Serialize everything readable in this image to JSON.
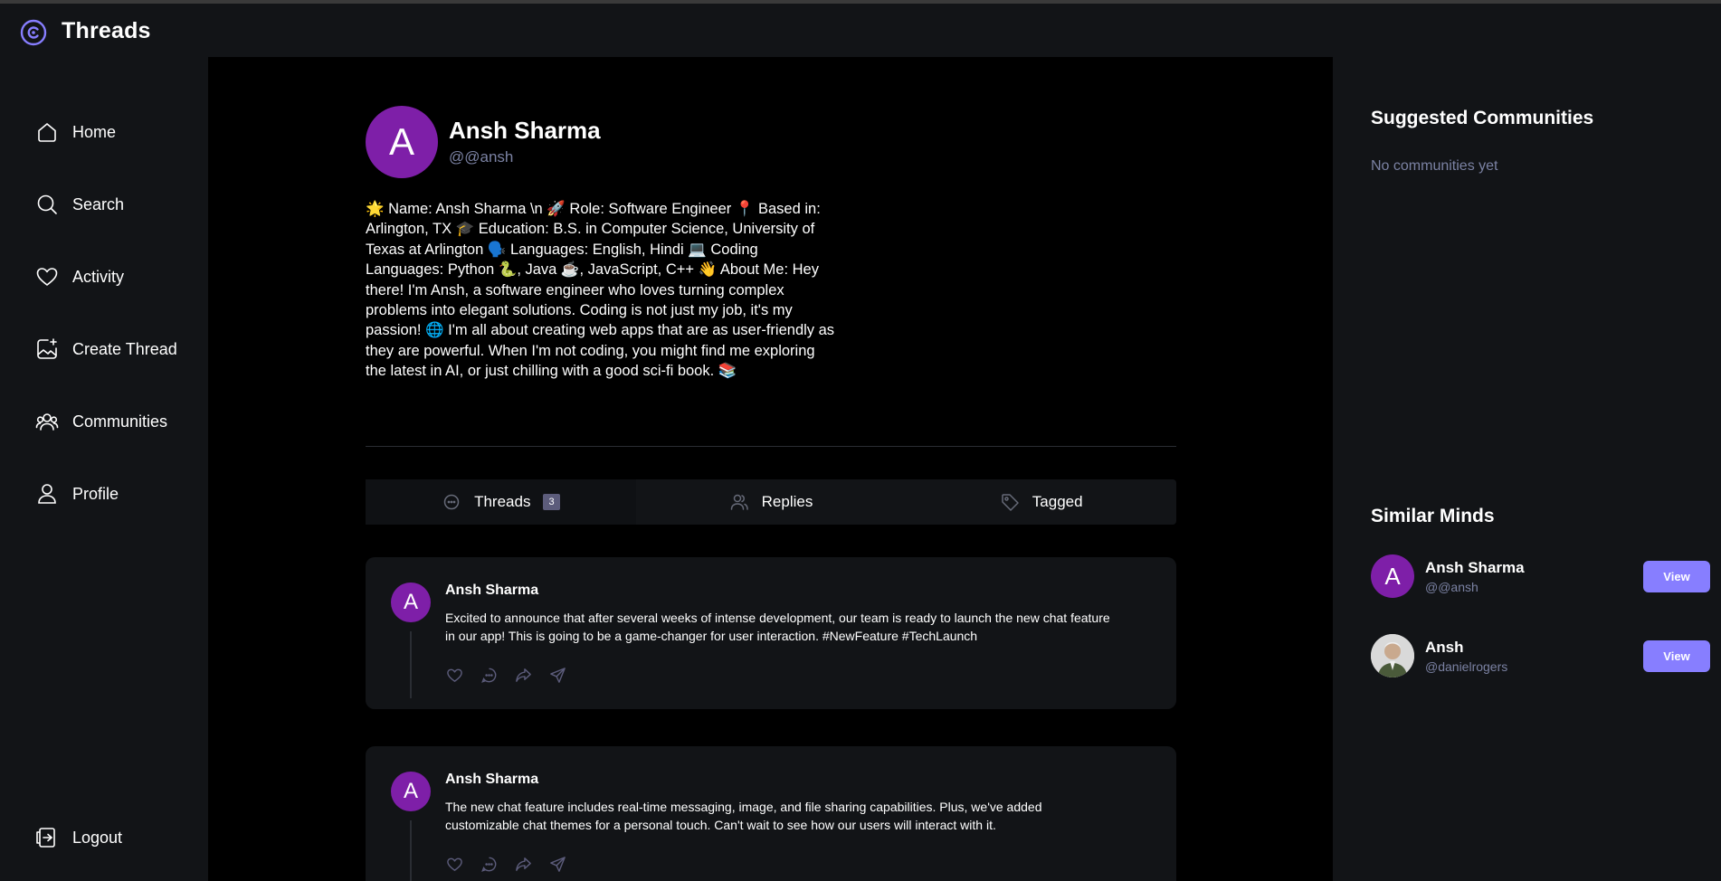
{
  "app": {
    "title": "Threads"
  },
  "sidebar": {
    "items": [
      {
        "label": "Home",
        "icon": "home-icon"
      },
      {
        "label": "Search",
        "icon": "search-icon"
      },
      {
        "label": "Activity",
        "icon": "heart-icon"
      },
      {
        "label": "Create Thread",
        "icon": "create-thread-icon"
      },
      {
        "label": "Communities",
        "icon": "communities-icon"
      },
      {
        "label": "Profile",
        "icon": "user-icon"
      }
    ],
    "logout_label": "Logout"
  },
  "profile": {
    "avatar_letter": "A",
    "name": "Ansh Sharma",
    "handle": "@@ansh",
    "bio": "🌟 Name: Ansh Sharma \\n 🚀 Role: Software Engineer 📍 Based in: Arlington, TX 🎓 Education: B.S. in Computer Science, University of Texas at Arlington 🗣️ Languages: English, Hindi 💻 Coding Languages: Python 🐍, Java ☕, JavaScript, C++ 👋 About Me: Hey there! I'm Ansh, a software engineer who loves turning complex problems into elegant solutions. Coding is not just my job, it's my passion! 🌐 I'm all about creating web apps that are as user-friendly as they are powerful. When I'm not coding, you might find me exploring the latest in AI, or just chilling with a good sci-fi book. 📚"
  },
  "tabs": [
    {
      "label": "Threads",
      "count": "3",
      "icon": "chat-bubble-icon"
    },
    {
      "label": "Replies",
      "icon": "members-icon"
    },
    {
      "label": "Tagged",
      "icon": "tag-icon"
    }
  ],
  "threads": [
    {
      "avatar_letter": "A",
      "author": "Ansh Sharma",
      "text": "Excited to announce that after several weeks of intense development, our team is ready to launch the new chat feature in our app! This is going to be a game-changer for user interaction. #NewFeature #TechLaunch"
    },
    {
      "avatar_letter": "A",
      "author": "Ansh Sharma",
      "text": "The new chat feature includes real-time messaging, image, and file sharing capabilities. Plus, we've added customizable chat themes for a personal touch. Can't wait to see how our users will interact with it."
    }
  ],
  "right_sidebar": {
    "suggested_title": "Suggested Communities",
    "suggested_empty": "No communities yet",
    "similar_title": "Similar Minds",
    "users": [
      {
        "avatar_letter": "A",
        "name": "Ansh Sharma",
        "handle": "@@ansh",
        "button": "View"
      },
      {
        "avatar_letter": "",
        "name": "Ansh",
        "handle": "@danielrogers",
        "button": "View"
      }
    ]
  },
  "colors": {
    "accent": "#877eff",
    "avatar_purple": "#7e1fa8",
    "muted_text": "#7b82a3",
    "background": "#121417",
    "main_background": "#000000"
  }
}
